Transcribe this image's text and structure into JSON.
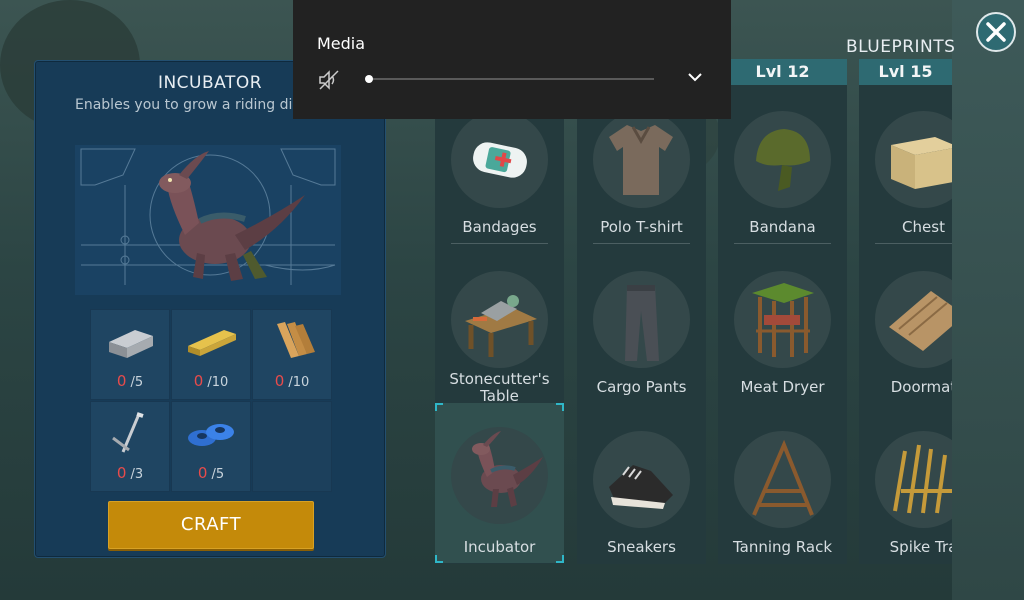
{
  "incubator": {
    "title": "INCUBATOR",
    "description": "Enables you to grow a riding di",
    "ingredients": [
      {
        "icon": "iron-ingot-icon",
        "have": "0",
        "need": "/5"
      },
      {
        "icon": "wood-plank-icon",
        "have": "0",
        "need": "/10"
      },
      {
        "icon": "log-bundle-icon",
        "have": "0",
        "need": "/10"
      },
      {
        "icon": "nails-icon",
        "have": "0",
        "need": "/3"
      },
      {
        "icon": "duct-tape-icon",
        "have": "0",
        "need": "/5"
      }
    ],
    "craft_label": "CRAFT"
  },
  "blueprints": {
    "label": "BLUEPRINTS",
    "columns": [
      {
        "level": "",
        "items": [
          "Bandages",
          "Stonecutter's Table",
          "Incubator"
        ]
      },
      {
        "level": "",
        "items": [
          "Polo T-shirt",
          "Cargo Pants",
          "Sneakers"
        ]
      },
      {
        "level": "Lvl 12",
        "items": [
          "Bandana",
          "Meat Dryer",
          "Tanning Rack"
        ]
      },
      {
        "level": "Lvl 15",
        "items": [
          "Chest",
          "Doormat",
          "Spike Tra"
        ]
      }
    ]
  },
  "media": {
    "title": "Media",
    "volume": 0
  },
  "colors": {
    "accent": "#2e6a72",
    "craft": "#c48a0a",
    "missing": "#e84b4b"
  }
}
